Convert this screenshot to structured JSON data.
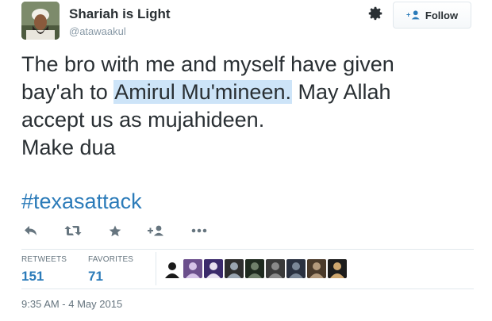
{
  "user": {
    "display_name": "Shariah is Light",
    "screen_name": "@atawaakul",
    "avatar_icon": "profile-photo"
  },
  "follow_button": {
    "label": "Follow",
    "icon": "add-user-icon"
  },
  "tweet": {
    "line1": "The bro with me and myself have given",
    "line2_before": "bay'ah to ",
    "line2_highlight": "Amirul Mu'mineen.",
    "line2_after": " May Allah",
    "line3": "accept us as mujahideen.",
    "line4": "Make dua",
    "hashtag": "#texasattack",
    "highlight_color": "#cde4f8",
    "link_color": "#2b7bb9"
  },
  "actions": [
    "reply-icon",
    "retweet-icon",
    "favorite-icon",
    "follow-icon",
    "more-icon"
  ],
  "stats": {
    "retweets_label": "RETWEETS",
    "retweets_count": "151",
    "favorites_label": "FAVORITES",
    "favorites_count": "71"
  },
  "favoriters": [
    {
      "colors": [
        "#ffffff",
        "#1a1a1a"
      ]
    },
    {
      "colors": [
        "#6b4f8c",
        "#d6c3e8"
      ]
    },
    {
      "colors": [
        "#3b2a6b",
        "#e8e0f0"
      ]
    },
    {
      "colors": [
        "#2e2e2e",
        "#9aa5b1"
      ]
    },
    {
      "colors": [
        "#1f2a1f",
        "#6f7f6a"
      ]
    },
    {
      "colors": [
        "#3a3a3a",
        "#8a8a8a"
      ]
    },
    {
      "colors": [
        "#2a3140",
        "#7b8797"
      ]
    },
    {
      "colors": [
        "#4a3a2a",
        "#b49a7c"
      ]
    },
    {
      "colors": [
        "#1c1c1c",
        "#cfa76e"
      ]
    }
  ],
  "timestamp": "9:35 AM - 4 May 2015"
}
